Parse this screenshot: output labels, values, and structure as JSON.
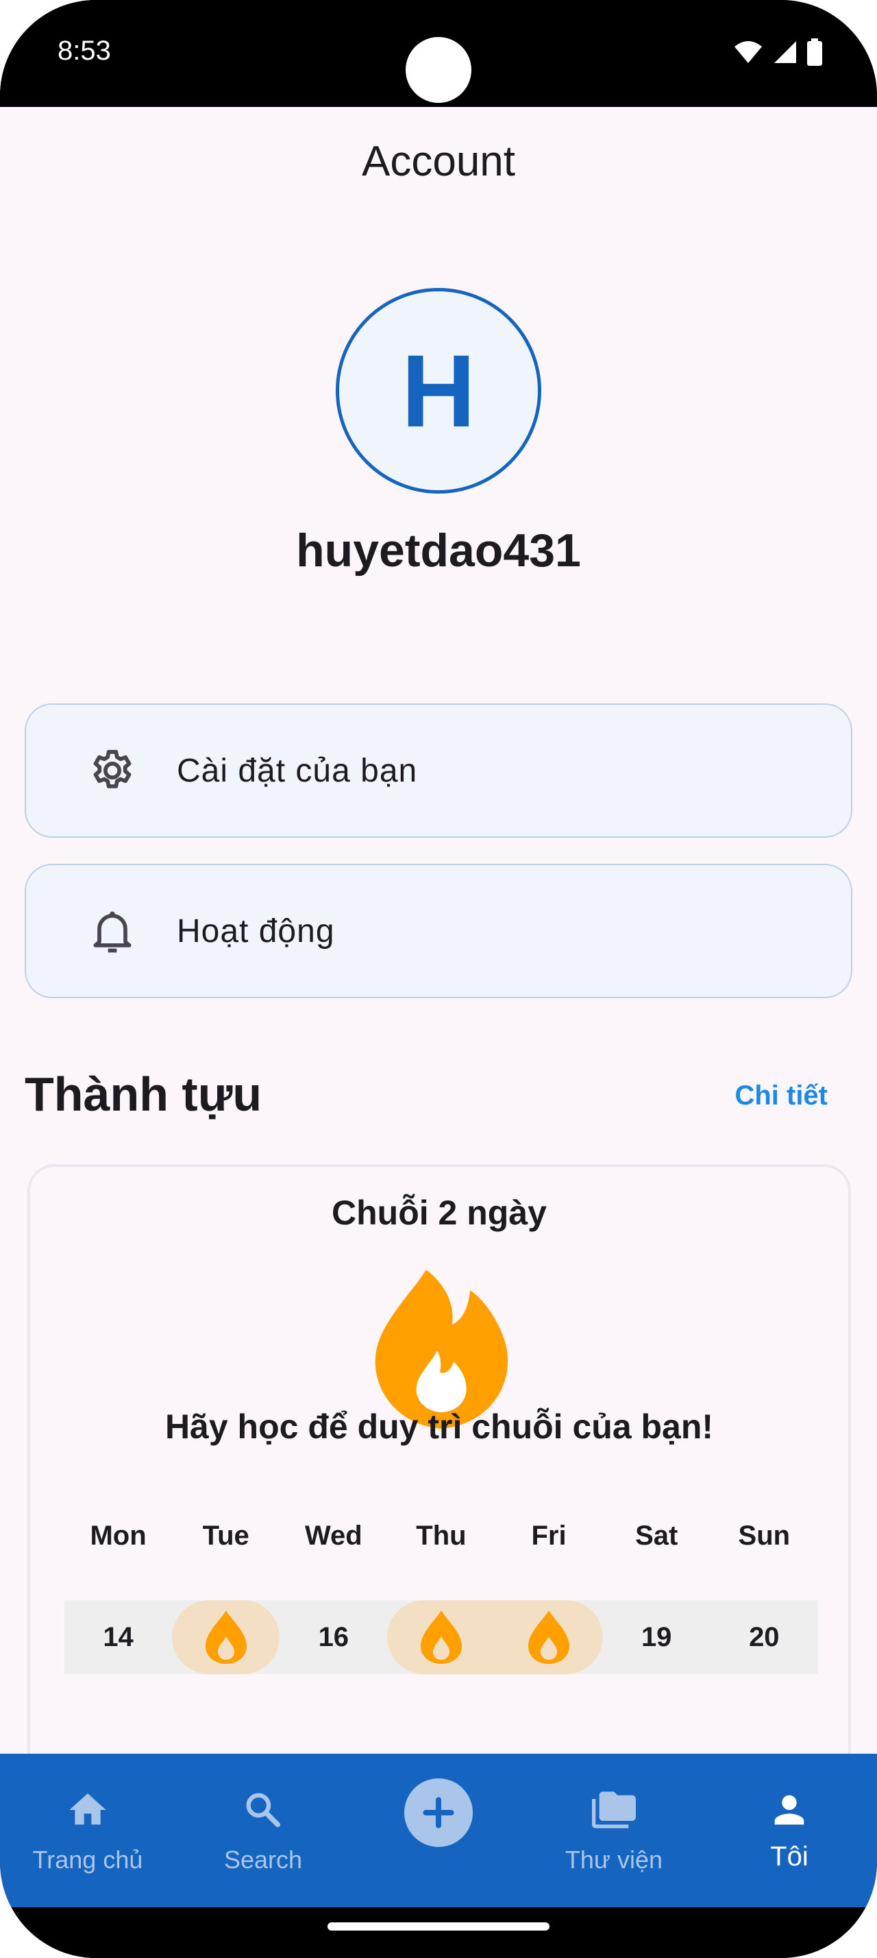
{
  "status_bar": {
    "time": "8:53"
  },
  "header": {
    "title": "Account"
  },
  "profile": {
    "initial": "H",
    "username": "huyetdao431"
  },
  "menu": [
    {
      "label": "Cài đặt của bạn",
      "icon": "gear-icon"
    },
    {
      "label": "Hoạt động",
      "icon": "bell-icon"
    }
  ],
  "achievements": {
    "title": "Thành tựu",
    "details_link": "Chi tiết",
    "streak_title": "Chuỗi 2 ngày",
    "message": "Hãy học để duy trì chuỗi của bạn!",
    "weekdays": [
      "Mon",
      "Tue",
      "Wed",
      "Thu",
      "Fri",
      "Sat",
      "Sun"
    ],
    "days": [
      {
        "label": "14",
        "active": false
      },
      {
        "label": "",
        "active": true
      },
      {
        "label": "16",
        "active": false
      },
      {
        "label": "",
        "active": true
      },
      {
        "label": "",
        "active": true
      },
      {
        "label": "19",
        "active": false
      },
      {
        "label": "20",
        "active": false
      }
    ]
  },
  "bottom_nav": [
    {
      "label": "Trang chủ",
      "icon": "home-icon"
    },
    {
      "label": "Search",
      "icon": "search-icon"
    },
    {
      "label": "",
      "icon": "add-icon"
    },
    {
      "label": "Thư viện",
      "icon": "folder-icon"
    },
    {
      "label": "Tôi",
      "icon": "person-icon",
      "active": true
    }
  ],
  "colors": {
    "primary": "#1565c0",
    "accent_link": "#1e88e5",
    "flame": "#ffa000",
    "streak_highlight": "#f3e0c4",
    "background": "#fcf6fb"
  }
}
